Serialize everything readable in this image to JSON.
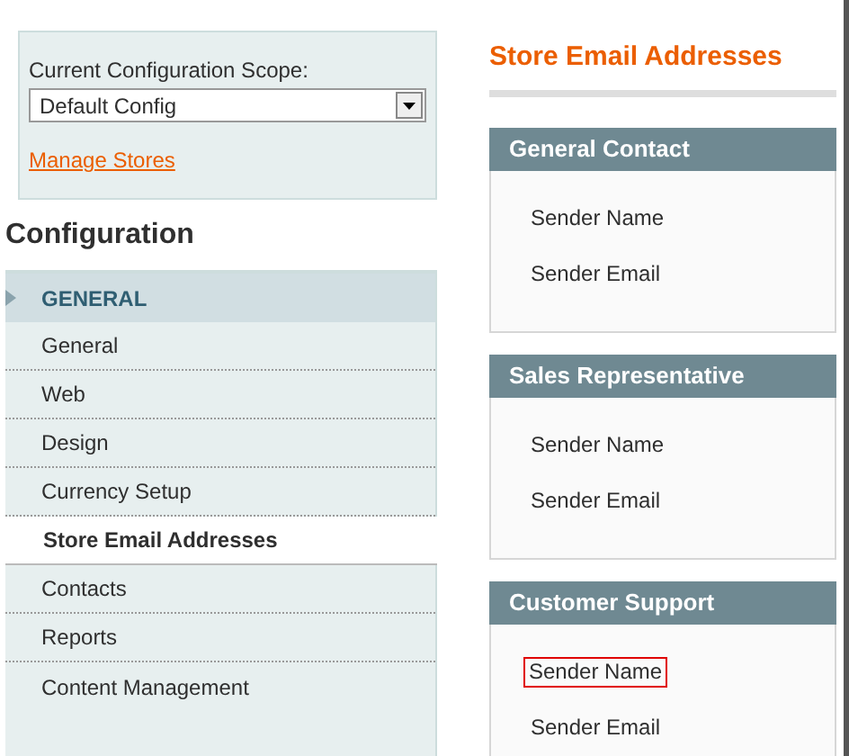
{
  "scope": {
    "label": "Current Configuration Scope:",
    "value": "Default Config",
    "link": "Manage Stores"
  },
  "sidebar": {
    "title": "Configuration",
    "section": {
      "label": "GENERAL",
      "expanded": true
    },
    "items": [
      {
        "label": "General",
        "selected": false
      },
      {
        "label": "Web",
        "selected": false
      },
      {
        "label": "Design",
        "selected": false
      },
      {
        "label": "Currency Setup",
        "selected": false
      },
      {
        "label": "Store Email Addresses",
        "selected": true
      },
      {
        "label": "Contacts",
        "selected": false
      },
      {
        "label": "Reports",
        "selected": false
      },
      {
        "label": "Content Management",
        "selected": false
      }
    ]
  },
  "page_title": "Store Email Addresses",
  "fieldsets": [
    {
      "title": "General Contact",
      "fields": [
        {
          "label": "Sender Name",
          "highlighted": false
        },
        {
          "label": "Sender Email",
          "highlighted": false
        }
      ]
    },
    {
      "title": "Sales Representative",
      "fields": [
        {
          "label": "Sender Name",
          "highlighted": false
        },
        {
          "label": "Sender Email",
          "highlighted": false
        }
      ]
    },
    {
      "title": "Customer Support",
      "fields": [
        {
          "label": "Sender Name",
          "highlighted": true
        },
        {
          "label": "Sender Email",
          "highlighted": false
        }
      ]
    }
  ]
}
